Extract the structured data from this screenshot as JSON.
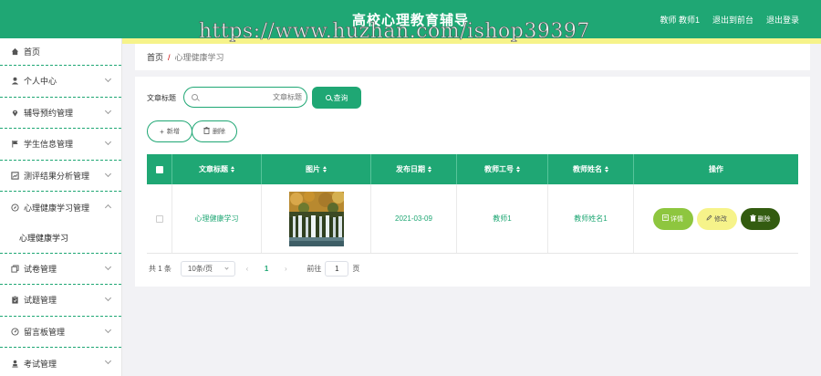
{
  "header": {
    "title": "高校心理教育辅导",
    "user": "教师 教师1",
    "back_label": "退出到前台",
    "logout_label": "退出登录",
    "watermark": "https://www.huzhan.com/ishop39397"
  },
  "sidebar": {
    "items": [
      {
        "label": "首页",
        "icon": "home-icon"
      },
      {
        "label": "个人中心",
        "icon": "user-icon"
      },
      {
        "label": "辅导预约管理",
        "icon": "location-icon"
      },
      {
        "label": "学生信息管理",
        "icon": "flag-icon"
      },
      {
        "label": "测评结果分析管理",
        "icon": "chart-icon"
      },
      {
        "label": "心理健康学习管理",
        "icon": "compass-icon"
      },
      {
        "label": "试卷管理",
        "icon": "copy-icon"
      },
      {
        "label": "试题管理",
        "icon": "clipboard-icon"
      },
      {
        "label": "留言板管理",
        "icon": "gauge-icon"
      },
      {
        "label": "考试管理",
        "icon": "person-icon"
      }
    ],
    "sub_item": "心理健康学习"
  },
  "breadcrumb": {
    "home": "首页",
    "separator": "/",
    "current": "心理健康学习"
  },
  "search": {
    "label": "文章标题",
    "placeholder": "文章标题",
    "query_label": "查询"
  },
  "actions": {
    "add_label": "新增",
    "delete_label": "删除"
  },
  "table": {
    "columns": [
      "文章标题",
      "图片",
      "发布日期",
      "教师工号",
      "教师姓名",
      "操作"
    ],
    "rows": [
      {
        "title": "心理健康学习",
        "date": "2021-03-09",
        "teacher_id": "教师1",
        "teacher_name": "教师姓名1",
        "detail_label": "详情",
        "edit_label": "修改",
        "delete_label": "删除"
      }
    ]
  },
  "pagination": {
    "total": "共 1 条",
    "page_size": "10条/页",
    "current_page": "1",
    "goto_label": "前往",
    "goto_value": "1",
    "page_unit": "页"
  },
  "colors": {
    "primary": "#1fa774",
    "accent_yellow": "#f6f38a",
    "detail_green": "#8ec63f",
    "delete_dark": "#335c10"
  }
}
